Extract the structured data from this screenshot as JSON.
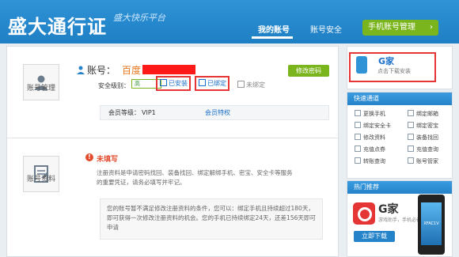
{
  "header": {
    "logo": "盛大通行证",
    "slogan": "盛大快乐平台",
    "nav": [
      {
        "label": "我的账号",
        "active": true
      },
      {
        "label": "账号安全",
        "active": false
      }
    ],
    "mobile_button": "手机账号管理",
    "mobile_arrow": "›"
  },
  "account_section": {
    "side_label": "账号管理",
    "account_prefix": "账号：",
    "account_name": "百度",
    "edit_password": "修改密码",
    "security_level_label": "安全级别：",
    "security_level_value": "高",
    "installed": "已安装",
    "bound": "已绑定",
    "unbound": "未绑定",
    "vip_label": "会员等级：",
    "vip_value": "VIP1",
    "vip_link": "会员特权"
  },
  "profile_section": {
    "side_label": "账号资料",
    "warning_icon": "!",
    "warning_title": "未填写",
    "info_text": "注册资料是申请密码找回、装备找回、绑定解绑手机、密宝、安全卡等服务的重要凭证，请务必填写并牢记。",
    "notice_text": "您的账号暂不满足修改注册资料的条件，您可以：绑定手机且持续超过180天，即可获得一次修改注册资料的机会。您的手机已持续绑定24天，还差156天即可申请"
  },
  "gjia": {
    "title": "G家",
    "subtitle": "点击下载安装"
  },
  "quick_links": {
    "header": "快速通道",
    "items": [
      "更换手机",
      "绑定邮箱",
      "绑定安全卡",
      "绑定密宝",
      "修改资料",
      "装备找回",
      "充值点券",
      "充值查询",
      "转账查询",
      "账号管家"
    ]
  },
  "promo": {
    "header": "热门推荐",
    "title": "G家",
    "subtitle": "游戏助手，手机必备",
    "button": "立即下载",
    "phone_text": "XFAC1V"
  }
}
